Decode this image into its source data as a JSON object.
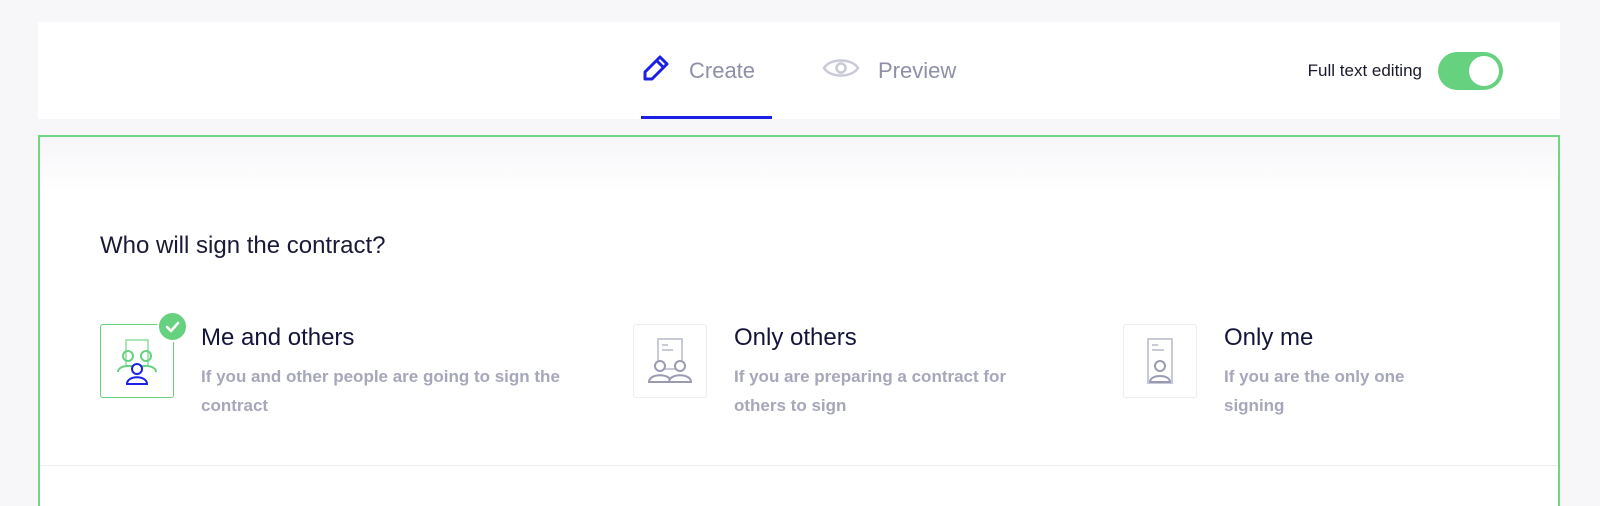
{
  "tabs": [
    {
      "label": "Create",
      "icon": "pencil-icon",
      "active": true
    },
    {
      "label": "Preview",
      "icon": "eye-icon",
      "active": false
    }
  ],
  "full_text_editing": {
    "label": "Full text editing",
    "enabled": true
  },
  "question": "Who will sign the contract?",
  "options": [
    {
      "title": "Me and others",
      "description": "If you and other people are going to sign the contract",
      "icon": "me-and-others-icon",
      "selected": true
    },
    {
      "title": "Only others",
      "description": "If you are preparing a contract for others to sign",
      "icon": "only-others-icon",
      "selected": false
    },
    {
      "title": "Only me",
      "description": "If you are the only one signing",
      "icon": "only-me-icon",
      "selected": false
    }
  ],
  "colors": {
    "accent_blue": "#1a20e6",
    "success_green": "#66d17f",
    "muted_text": "#a6a7ba",
    "dark_text": "#14143a"
  }
}
